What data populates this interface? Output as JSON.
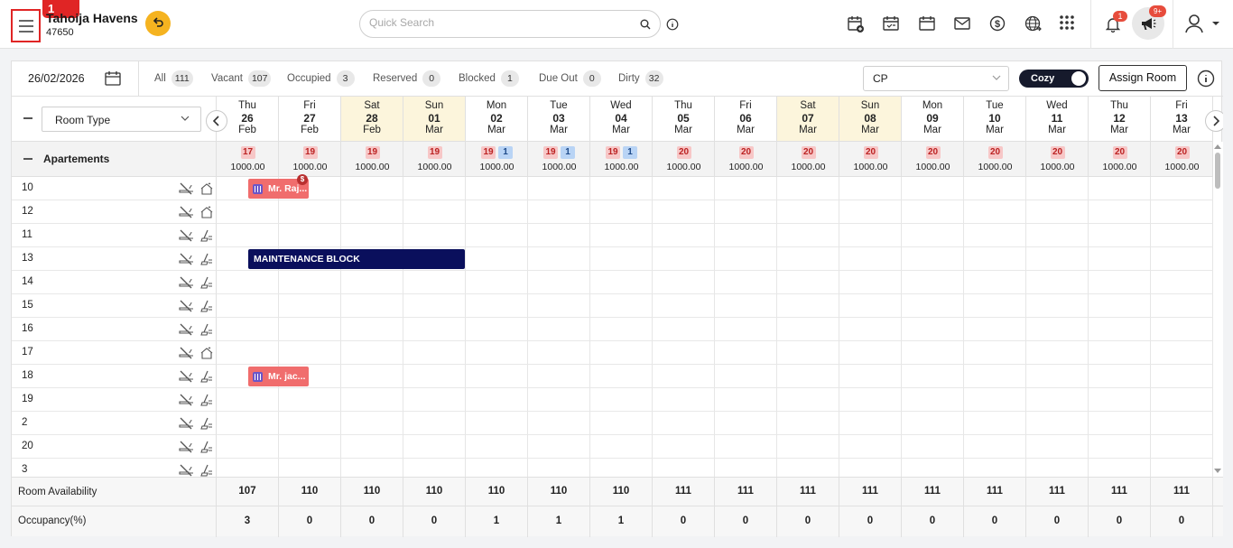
{
  "header": {
    "menu_badge": "1",
    "hotel_name": "Tahoija Havens",
    "hotel_code": "47650",
    "search_placeholder": "Quick Search",
    "notification_count": "1",
    "announcement_count": "9+"
  },
  "toolbar": {
    "date": "26/02/2026",
    "stats": [
      {
        "label": "All",
        "count": "111"
      },
      {
        "label": "Vacant",
        "count": "107"
      },
      {
        "label": "Occupied",
        "count": "3"
      },
      {
        "label": "Reserved",
        "count": "0"
      },
      {
        "label": "Blocked",
        "count": "1"
      },
      {
        "label": "Due Out",
        "count": "0"
      },
      {
        "label": "Dirty",
        "count": "32"
      }
    ],
    "rate_plan": "CP",
    "view_toggle": "Cozy",
    "assign_button": "Assign Room"
  },
  "grid": {
    "room_type_filter": "Room Type",
    "category": "Apartements",
    "days": [
      {
        "dow": "Thu",
        "date": "26",
        "month": "Feb",
        "weekend": false,
        "avail": "17",
        "blocked": "",
        "rate": "1000.00"
      },
      {
        "dow": "Fri",
        "date": "27",
        "month": "Feb",
        "weekend": false,
        "avail": "19",
        "blocked": "",
        "rate": "1000.00"
      },
      {
        "dow": "Sat",
        "date": "28",
        "month": "Feb",
        "weekend": true,
        "avail": "19",
        "blocked": "",
        "rate": "1000.00"
      },
      {
        "dow": "Sun",
        "date": "01",
        "month": "Mar",
        "weekend": true,
        "avail": "19",
        "blocked": "",
        "rate": "1000.00"
      },
      {
        "dow": "Mon",
        "date": "02",
        "month": "Mar",
        "weekend": false,
        "avail": "19",
        "blocked": "1",
        "rate": "1000.00"
      },
      {
        "dow": "Tue",
        "date": "03",
        "month": "Mar",
        "weekend": false,
        "avail": "19",
        "blocked": "1",
        "rate": "1000.00"
      },
      {
        "dow": "Wed",
        "date": "04",
        "month": "Mar",
        "weekend": false,
        "avail": "19",
        "blocked": "1",
        "rate": "1000.00"
      },
      {
        "dow": "Thu",
        "date": "05",
        "month": "Mar",
        "weekend": false,
        "avail": "20",
        "blocked": "",
        "rate": "1000.00"
      },
      {
        "dow": "Fri",
        "date": "06",
        "month": "Mar",
        "weekend": false,
        "avail": "20",
        "blocked": "",
        "rate": "1000.00"
      },
      {
        "dow": "Sat",
        "date": "07",
        "month": "Mar",
        "weekend": true,
        "avail": "20",
        "blocked": "",
        "rate": "1000.00"
      },
      {
        "dow": "Sun",
        "date": "08",
        "month": "Mar",
        "weekend": true,
        "avail": "20",
        "blocked": "",
        "rate": "1000.00"
      },
      {
        "dow": "Mon",
        "date": "09",
        "month": "Mar",
        "weekend": false,
        "avail": "20",
        "blocked": "",
        "rate": "1000.00"
      },
      {
        "dow": "Tue",
        "date": "10",
        "month": "Mar",
        "weekend": false,
        "avail": "20",
        "blocked": "",
        "rate": "1000.00"
      },
      {
        "dow": "Wed",
        "date": "11",
        "month": "Mar",
        "weekend": false,
        "avail": "20",
        "blocked": "",
        "rate": "1000.00"
      },
      {
        "dow": "Thu",
        "date": "12",
        "month": "Mar",
        "weekend": false,
        "avail": "20",
        "blocked": "",
        "rate": "1000.00"
      },
      {
        "dow": "Fri",
        "date": "13",
        "month": "Mar",
        "weekend": false,
        "avail": "20",
        "blocked": "",
        "rate": "1000.00"
      }
    ],
    "rooms": [
      {
        "number": "10",
        "clean": true
      },
      {
        "number": "12",
        "clean": true
      },
      {
        "number": "11",
        "clean": false
      },
      {
        "number": "13",
        "clean": false
      },
      {
        "number": "14",
        "clean": false
      },
      {
        "number": "15",
        "clean": false
      },
      {
        "number": "16",
        "clean": false
      },
      {
        "number": "17",
        "clean": true
      },
      {
        "number": "18",
        "clean": false
      },
      {
        "number": "19",
        "clean": false
      },
      {
        "number": "2",
        "clean": false
      },
      {
        "number": "20",
        "clean": false
      },
      {
        "number": "3",
        "clean": false
      }
    ],
    "bookings": [
      {
        "room_index": 0,
        "guest": "Mr. Raj...",
        "start_day": 0,
        "nights": 1,
        "pay_badge": "$"
      },
      {
        "room_index": 8,
        "guest": "Mr. jac...",
        "start_day": 0,
        "nights": 1,
        "pay_badge": ""
      }
    ],
    "maintenance": {
      "room_index": 3,
      "label": "MAINTENANCE BLOCK",
      "start_day": 0,
      "nights": 3.5
    }
  },
  "footer": {
    "availability_label": "Room Availability",
    "availability": [
      "107",
      "110",
      "110",
      "110",
      "110",
      "110",
      "110",
      "111",
      "111",
      "111",
      "111",
      "111",
      "111",
      "111",
      "111",
      "111"
    ],
    "occupancy_label": "Occupancy(%)",
    "occupancy": [
      "3",
      "0",
      "0",
      "0",
      "1",
      "1",
      "1",
      "0",
      "0",
      "0",
      "0",
      "0",
      "0",
      "0",
      "0",
      "0"
    ]
  },
  "colors": {
    "weekend": "#fcf5dc",
    "booking": "#f06d6d",
    "maintenance": "#0a0f5c",
    "accent_red": "#e02525"
  }
}
